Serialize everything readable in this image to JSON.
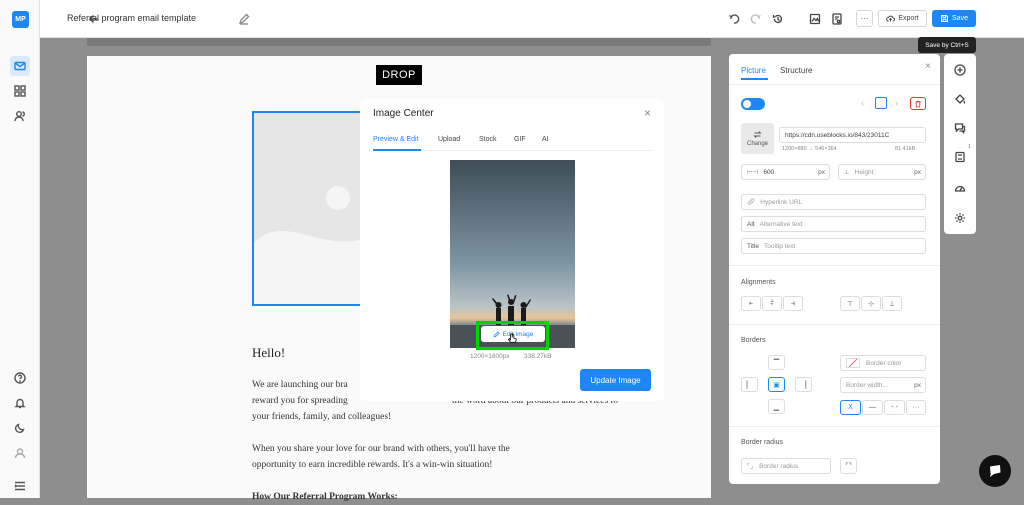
{
  "app": {
    "logo_text": "MP"
  },
  "header": {
    "title": "Referral program email template",
    "export_label": "Export",
    "save_label": "Save",
    "save_tooltip": "Save by Ctrl+S"
  },
  "email": {
    "logo_text": "DROP",
    "greeting": "Hello!",
    "paragraph1_line1": "We are launching our bra",
    "paragraph1_line1_tail": "the word about our products and services to",
    "paragraph1_line2": "reward you for spreading",
    "paragraph1_line3": "your friends, family, and colleagues!",
    "paragraph2_line1": "When you share your love for our brand with others, you'll have the",
    "paragraph2_line2": "opportunity to earn incredible rewards. It's a win-win situation!",
    "heading3": "How Our Referral Program Works:"
  },
  "modal": {
    "title": "Image Center",
    "tabs": [
      "Preview & Edit",
      "Upload",
      "Stock",
      "GIF",
      "AI"
    ],
    "active_tab": "Preview & Edit",
    "edit_label": "Edit image",
    "dimensions": "1200×1800px",
    "filesize": "338.27kB",
    "update_label": "Update Image"
  },
  "panel": {
    "tabs": [
      "Picture",
      "Structure"
    ],
    "active_tab": "Picture",
    "image_url": "https://cdn.useblocks.io/843/23011C",
    "image_size_info": "1200×880 → 546×364",
    "image_kb": "81.41kB",
    "change_label": "Change",
    "width_value": "600",
    "width_unit": "px",
    "height_placeholder": "Height",
    "height_unit": "px",
    "hyperlink_placeholder": "Hyperlink URL",
    "alt_prefix": "Alt",
    "alt_placeholder": "Alternative text",
    "title_prefix": "Title",
    "title_placeholder": "Tooltip text",
    "alignments_label": "Alignments",
    "borders_label": "Borders",
    "border_color_placeholder": "Border color",
    "border_width_placeholder": "Border width...",
    "border_width_unit": "px",
    "border_radius_label": "Border radius",
    "border_radius_placeholder": "Border radius"
  },
  "right_strip": {
    "badge_count": "1"
  },
  "colors": {
    "accent": "#1e86f5",
    "highlight": "#00d400",
    "danger": "#e53935"
  }
}
